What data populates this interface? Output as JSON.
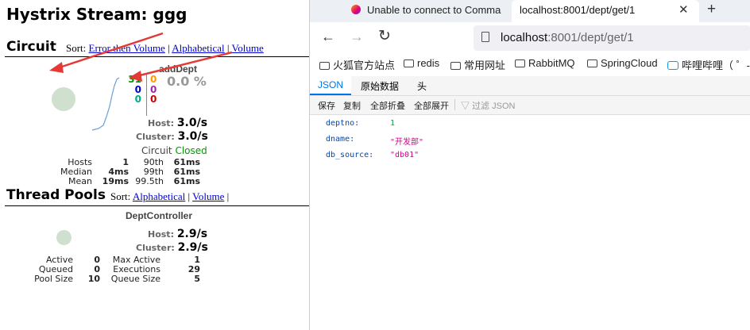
{
  "hystrix": {
    "title": "Hystrix Stream: ggg",
    "circuit_header": "Circuit",
    "sort_label": "Sort:",
    "circuit_sort": [
      "Error then Volume",
      "Alphabetical",
      "Volume"
    ],
    "separator": "|",
    "circuit": {
      "name": "addDept",
      "count_success": "31",
      "count_short": "0",
      "count_badreq": "0",
      "count_timeout": "0",
      "count_rejected": "0",
      "count_failure": "0",
      "error_rate": "0.0 %",
      "host_label": "Host:",
      "host_rate": "3.0/s",
      "cluster_label": "Cluster:",
      "cluster_rate": "3.0/s",
      "circuit_label": "Circuit",
      "circuit_status": "Closed",
      "stats": {
        "hosts_label": "Hosts",
        "hosts": "1",
        "median_label": "Median",
        "median": "4ms",
        "mean_label": "Mean",
        "mean": "19ms",
        "p90_label": "90th",
        "p90": "61ms",
        "p99_label": "99th",
        "p99": "61ms",
        "p995_label": "99.5th",
        "p995": "61ms"
      }
    },
    "threadpool_header": "Thread Pools",
    "threadpool_sort": [
      "Alphabetical",
      "Volume"
    ],
    "threadpool": {
      "name": "DeptController",
      "host_label": "Host:",
      "host_rate": "2.9/s",
      "cluster_label": "Cluster:",
      "cluster_rate": "2.9/s",
      "stats": {
        "active_label": "Active",
        "active": "0",
        "queued_label": "Queued",
        "queued": "0",
        "poolsize_label": "Pool Size",
        "poolsize": "10",
        "maxactive_label": "Max Active",
        "maxactive": "1",
        "executions_label": "Executions",
        "executions": "29",
        "queuesize_label": "Queue Size",
        "queuesize": "5"
      }
    },
    "colors": {
      "success": "#090",
      "short": "#ff9900",
      "badreq": "#00c",
      "timeout": "#f90",
      "rejected": "#9c27b0",
      "failure": "#c00",
      "arrow": "#e53935"
    }
  },
  "browser": {
    "tab1_title": "Unable to connect to Comma",
    "tab2_title": "localhost:8001/dept/get/1",
    "url_host": "localhost",
    "url_rest": ":8001/dept/get/1",
    "bookmarks": [
      "火狐官方站点",
      "redis",
      "常用网址",
      "RabbitMQ",
      "SpringCloud",
      "哔哩哔哩（ ゜-"
    ],
    "json_tabs": [
      "JSON",
      "原始数据",
      "头"
    ],
    "toolbar": [
      "保存",
      "复制",
      "全部折叠",
      "全部展开"
    ],
    "filter_placeholder": "过滤 JSON",
    "json": [
      {
        "key": "deptno:",
        "value": "1",
        "type": "number"
      },
      {
        "key": "dname:",
        "value": "\"开发部\"",
        "type": "string"
      },
      {
        "key": "db_source:",
        "value": "\"db01\"",
        "type": "string"
      }
    ],
    "icons": [
      "firefox-icon",
      "close-icon",
      "plus-icon",
      "back-icon",
      "forward-icon",
      "reload-icon",
      "page-icon",
      "folder-icon",
      "bilibili-icon",
      "filter-icon"
    ]
  }
}
